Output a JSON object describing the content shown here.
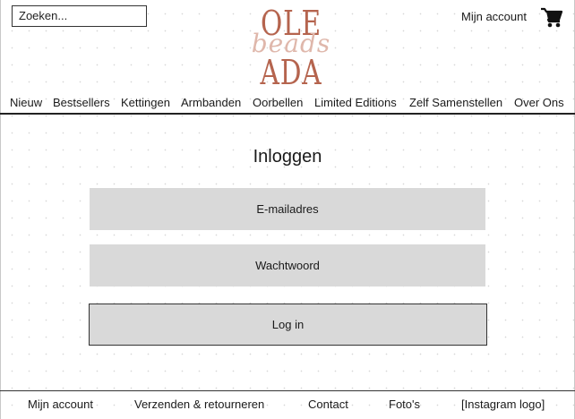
{
  "header": {
    "search_placeholder": "Zoeken...",
    "logo": {
      "line1": "OLE",
      "script": "beads",
      "line2": "ADA",
      "color": "#b5644e"
    },
    "account_label": "Mijn account",
    "cart_icon": "shopping-cart-icon"
  },
  "nav": {
    "items": [
      {
        "label": "Nieuw"
      },
      {
        "label": "Bestsellers"
      },
      {
        "label": "Kettingen"
      },
      {
        "label": "Armbanden"
      },
      {
        "label": "Oorbellen"
      },
      {
        "label": "Limited Editions"
      },
      {
        "label": "Zelf Samenstellen"
      },
      {
        "label": "Over Ons"
      }
    ]
  },
  "login": {
    "title": "Inloggen",
    "email_placeholder": "E-mailadres",
    "password_placeholder": "Wachtwoord",
    "submit_label": "Log in"
  },
  "footer": {
    "items": [
      {
        "label": "Mijn account"
      },
      {
        "label": "Verzenden & retourneren"
      },
      {
        "label": "Contact"
      },
      {
        "label": "Foto's"
      },
      {
        "label": "[Instagram logo]"
      }
    ]
  }
}
